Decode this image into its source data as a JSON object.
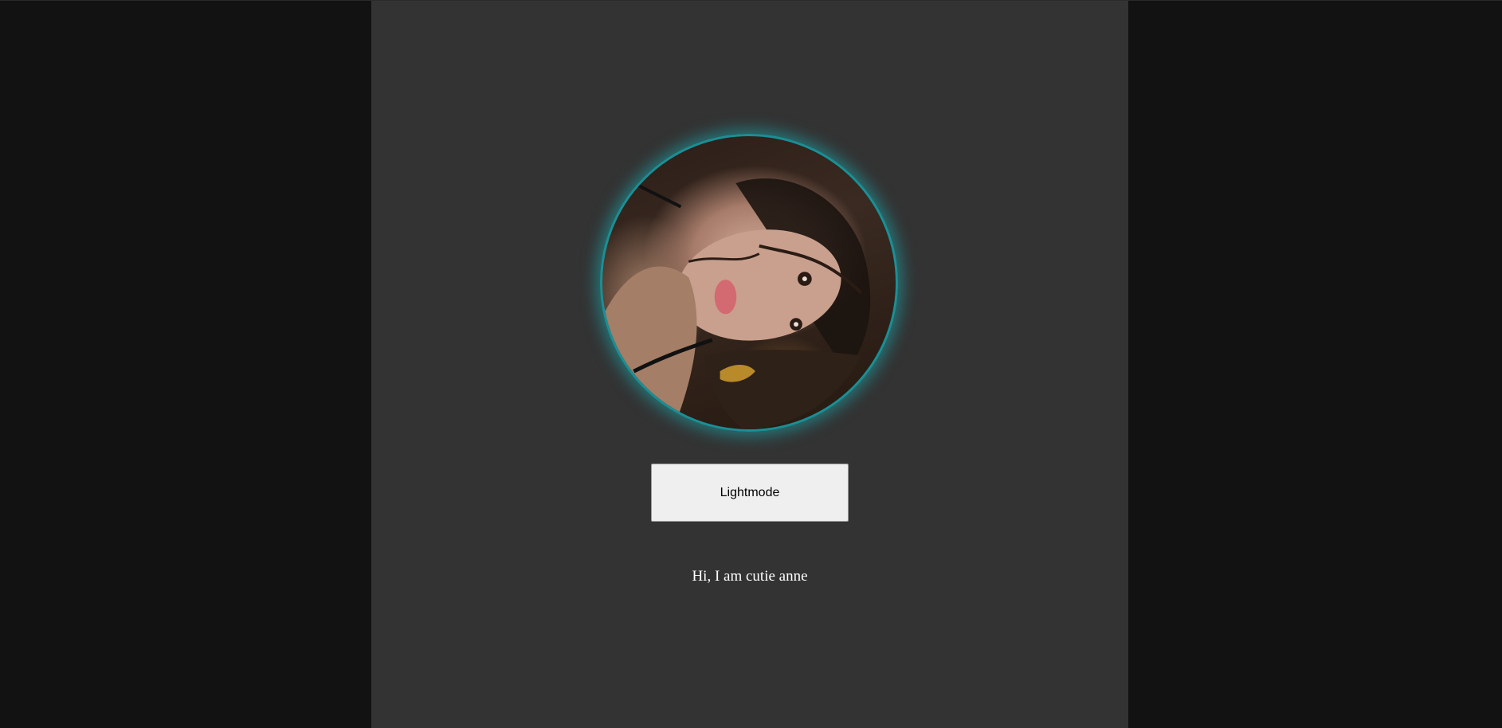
{
  "profile": {
    "avatar_alt": "profile photo",
    "avatar_border_color": "#1a8f95",
    "avatar_glow_color": "#1caaaf"
  },
  "theme_toggle": {
    "label": "Lightmode"
  },
  "greeting": {
    "text": "Hi, I am cutie anne"
  },
  "colors": {
    "page_background": "#121212",
    "column_background": "#333333",
    "button_background": "#efefef",
    "text_color": "#ffffff"
  }
}
